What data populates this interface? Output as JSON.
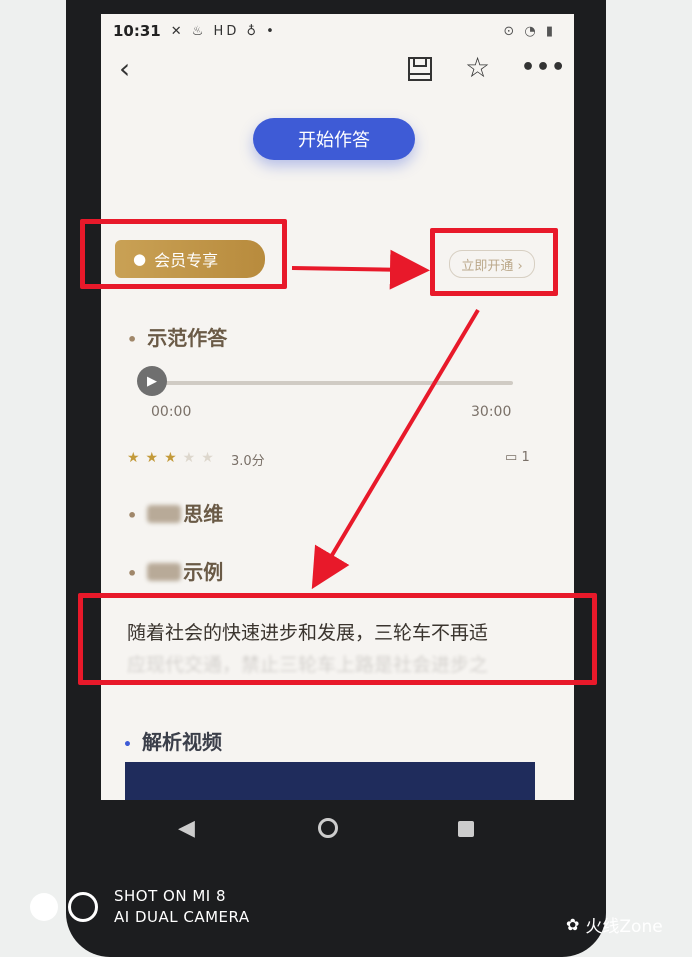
{
  "status_bar": {
    "time": "10:31",
    "left_icons": "✕ ♨ HD ♁ •",
    "right_icons": "⊙ ◔ ▮"
  },
  "toolbar": {
    "back_icon": "‹",
    "star_icon": "☆",
    "more_icon": "•••"
  },
  "start_button": "开始作答",
  "vip_badge": {
    "icon": "●",
    "label": "会员专享"
  },
  "open_button": "立即开通 ›",
  "sections": {
    "demo_answer": "示范作答",
    "thinking": "思维",
    "example": "示例",
    "analysis_video": "解析视频"
  },
  "player": {
    "current_time": "00:00",
    "total_time": "30:00"
  },
  "rating": {
    "stars_filled": 3,
    "stars_total": 5,
    "score": "3.0分",
    "comments": "1"
  },
  "body": {
    "line1": "随着社会的快速进步和发展，三轮车不再适",
    "line2": "应现代交通，禁止三轮车上路是社会进步之"
  },
  "watermark": {
    "line1": "SHOT ON MI 8",
    "line2": "AI DUAL CAMERA"
  },
  "brand": "火线Zone",
  "colors": {
    "accent": "#3e5bd6",
    "vip_gold": "#c9a155",
    "callout_red": "#e8192a"
  }
}
